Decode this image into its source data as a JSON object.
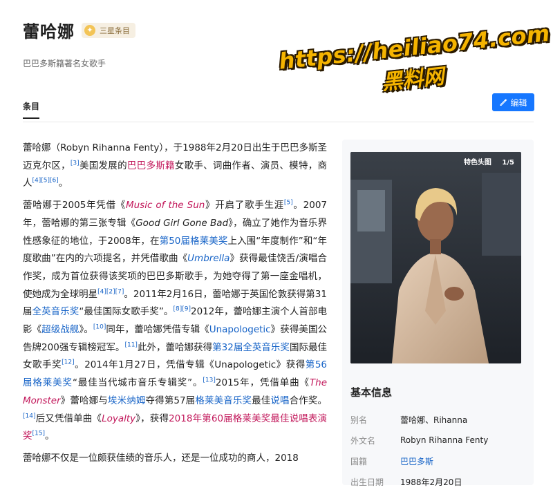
{
  "header": {
    "title": "蕾哈娜",
    "badge_label": "三星条目",
    "badge_icon": "star-medal-icon",
    "subtitle": "巴巴多斯籍著名女歌手"
  },
  "watermark": {
    "url": "https://heiliao74.com",
    "name": "黑料网"
  },
  "tabs": {
    "active": "条目"
  },
  "edit_button": {
    "label": "编辑",
    "icon": "pencil-icon",
    "color": "#1677ff"
  },
  "article": {
    "p1": {
      "t1": "蕾哈娜（Robyn Rihanna Fenty），于1988年2月20日出生于巴巴多斯圣迈克尔区，",
      "r1": "[3]",
      "t2": "美国发展的",
      "l1": "巴巴多斯籍",
      "t3": "女歌手、词曲作者、演员、模特，商人",
      "r2": "[4][5][6]",
      "t4": "。"
    },
    "p2": {
      "t1": "蕾哈娜于2005年凭借《",
      "i1": "Music of the Sun",
      "t2": "》开启了歌手生涯",
      "r1": "[5]",
      "t3": "。2007年，蕾哈娜的第三张专辑《",
      "i2": "Good Girl Gone Bad",
      "t4": "》，确立了她作为音乐界性感象征的地位，于2008年，在",
      "l1": "第50届格莱美奖",
      "t5": "上入围“年度制作”和“年度歌曲”在内的六项提名，并凭借歌曲《",
      "i3": "Umbrella",
      "t6": "》获得最佳饶舌/演唱合作奖，成为首位获得该奖项的巴巴多斯歌手，为她夺得了第一座金唱机，使她成为全球明星",
      "r2": "[4][2][7]",
      "t7": "。2011年2月16日，蕾哈娜于英国伦敦获得第31届",
      "l2": "全英音乐奖",
      "t8": "“最佳国际女歌手奖”。",
      "r3": "[8][9]",
      "t9": "2012年，蕾哈娜主演个人首部电影《",
      "l3": "超级战舰",
      "t10": "》。",
      "r4": "[10]",
      "t11": "同年，蕾哈娜凭借专辑《",
      "l4": "Unapologetic",
      "t12": "》获得美国公告牌200强专辑榜冠军。",
      "r5": "[11]",
      "t13": "此外，蕾哈娜获得",
      "l5": "第32届全英音乐奖",
      "t14": "国际最佳女歌手奖",
      "r6": "[12]",
      "t15": "。2014年1月27日，凭借专辑《Unapologetic》获得",
      "l6": "第56届格莱美奖",
      "t16": "“最佳当代城市音乐专辑奖”。",
      "r7": "[13]",
      "t17": "2015年，凭借单曲《",
      "i4": "The Monster",
      "t18": "》蕾哈娜与",
      "l7": "埃米纳姆",
      "t19": "夺得第57届",
      "l8": "格莱美音乐奖",
      "t20": "最佳",
      "l9": "说唱",
      "t21": "合作奖。",
      "r8": "[14]",
      "t22": "后又凭借单曲《",
      "i5": "Loyalty",
      "t23": "》，获得",
      "l10": "2018年第60届格莱美奖最佳说唱表演奖",
      "r9": "[15]",
      "t24": "。"
    },
    "p3": {
      "t1": "蕾哈娜不仅是一位颇获佳绩的音乐人，还是一位成功的商人，2018"
    }
  },
  "sidebar": {
    "photo_label": "特色头图",
    "photo_counter": "1/5",
    "info_title": "基本信息",
    "info": [
      {
        "key": "别名",
        "value": "蕾哈娜、Rihanna"
      },
      {
        "key": "外文名",
        "value": "Robyn Rihanna Fenty"
      },
      {
        "key": "国籍",
        "value": "巴巴多斯"
      },
      {
        "key": "出生日期",
        "value": "1988年2月20日"
      }
    ]
  }
}
